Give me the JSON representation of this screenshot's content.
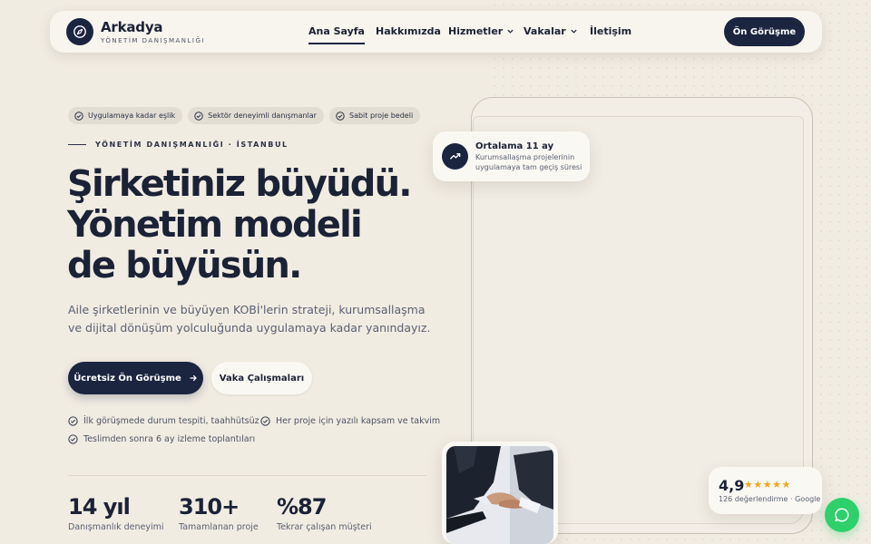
{
  "brand": {
    "name": "Arkadya",
    "tagline": "YÖNETİM DANIŞMANLIĞI"
  },
  "nav": {
    "items": [
      {
        "label": "Ana Sayfa",
        "active": true,
        "dropdown": false
      },
      {
        "label": "Hakkımızda",
        "active": false,
        "dropdown": false
      },
      {
        "label": "Hizmetler",
        "active": false,
        "dropdown": true
      },
      {
        "label": "Vakalar",
        "active": false,
        "dropdown": true
      },
      {
        "label": "İletişim",
        "active": false,
        "dropdown": false
      }
    ],
    "cta": "Ön Görüşme"
  },
  "hero": {
    "chips": [
      "Uygulamaya kadar eşlik",
      "Sektör deneyimli danışmanlar",
      "Sabit proje bedeli"
    ],
    "eyebrow": "YÖNETİM DANIŞMANLIĞI · İSTANBUL",
    "headline": [
      "Şirketiniz büyüdü.",
      "Yönetim modeli",
      "de büyüsün."
    ],
    "lead": "Aile şirketlerinin ve büyüyen KOBİ'lerin strateji, kurumsallaşma ve dijital dönüşüm yolculuğunda uygulamaya kadar yanındayız.",
    "primary_cta": "Ücretsiz Ön Görüşme",
    "secondary_cta": "Vaka Çalışmaları",
    "checks": [
      "İlk görüşmede durum tespiti, taahhütsüz",
      "Her proje için yazılı kapsam ve takvim",
      "Teslimden sonra 6 ay izleme toplantıları"
    ],
    "stats": [
      {
        "value": "14 yıl",
        "label": "Danışmanlık deneyimi"
      },
      {
        "value": "310+",
        "label": "Tamamlanan proje"
      },
      {
        "value": "%87",
        "label": "Tekrar çalışan müşteri"
      }
    ]
  },
  "float_card": {
    "title": "Ortalama 11 ay",
    "subtitle": "Kurumsallaşma projelerinin uygulamaya tam geçiş süresi",
    "icon": "trending-up-icon"
  },
  "rating": {
    "score": "4,9",
    "stars": "★★★★★",
    "meta": "126 değerlendirme · Google"
  },
  "colors": {
    "navy": "#1b2540",
    "background": "#f1ece2",
    "whatsapp": "#2ed06b",
    "star": "#f2a71b"
  }
}
